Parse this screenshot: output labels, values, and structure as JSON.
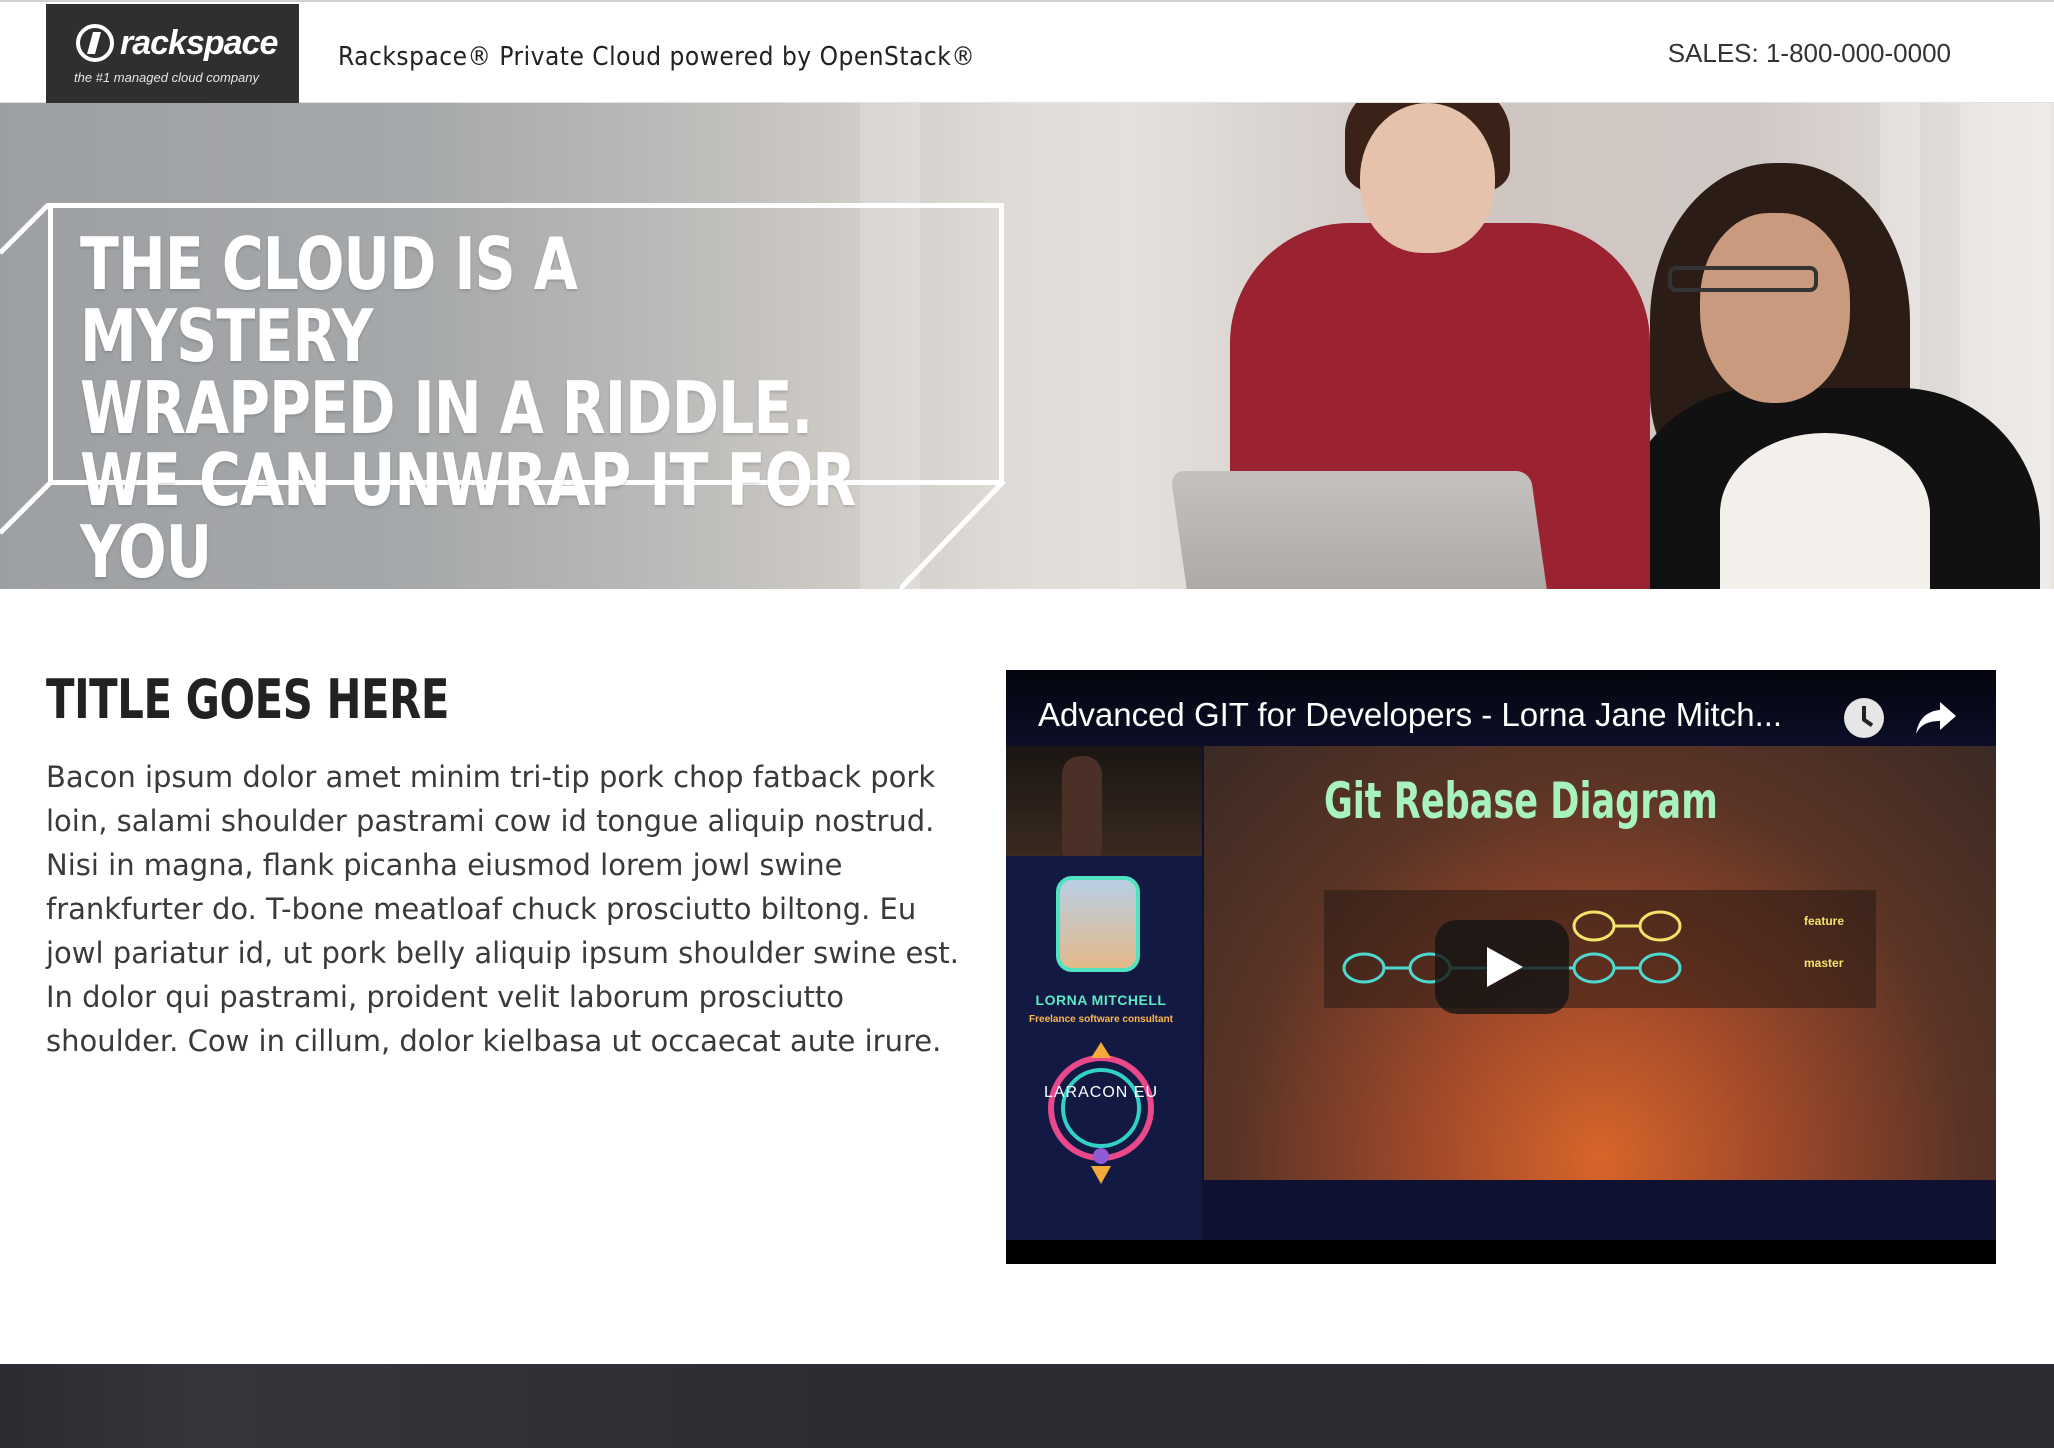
{
  "header": {
    "logo_word": "rackspace",
    "logo_tagline": "the #1 managed cloud company",
    "site_title": "Rackspace® Private Cloud powered by OpenStack®",
    "sales": "SALES: 1-800-000-0000"
  },
  "hero": {
    "headline_lines": [
      "THE CLOUD IS A MYSTERY",
      "WRAPPED IN A RIDDLE.",
      "WE CAN UNWRAP IT FOR YOU"
    ]
  },
  "content": {
    "title": "TITLE GOES HERE",
    "body": "Bacon ipsum dolor amet minim tri-tip pork chop fatback pork loin, salami shoulder pastrami cow id tongue aliquip nostrud. Nisi in magna, flank picanha eiusmod lorem jowl swine frankfurter do. T-bone meatloaf chuck prosciutto biltong. Eu jowl pariatur id, ut pork belly aliquip ipsum shoulder swine est. In dolor qui pastrami, proident velit laborum prosciutto shoulder. Cow in cillum, dolor kielbasa ut occaecat aute irure."
  },
  "video": {
    "title": "Advanced GIT for Developers - Lorna Jane Mitch...",
    "speaker_name": "LORNA MITCHELL",
    "speaker_role": "Freelance software consultant",
    "conference": "LARACON EU",
    "slide_title": "Git Rebase Diagram",
    "branch_feature": "feature",
    "branch_master": "master"
  },
  "colors": {
    "logo_bg": "#2f2f2f",
    "accent_teal": "#5fe8c4",
    "slide_title": "#a8f2bf",
    "footer": "#2a2c31"
  }
}
